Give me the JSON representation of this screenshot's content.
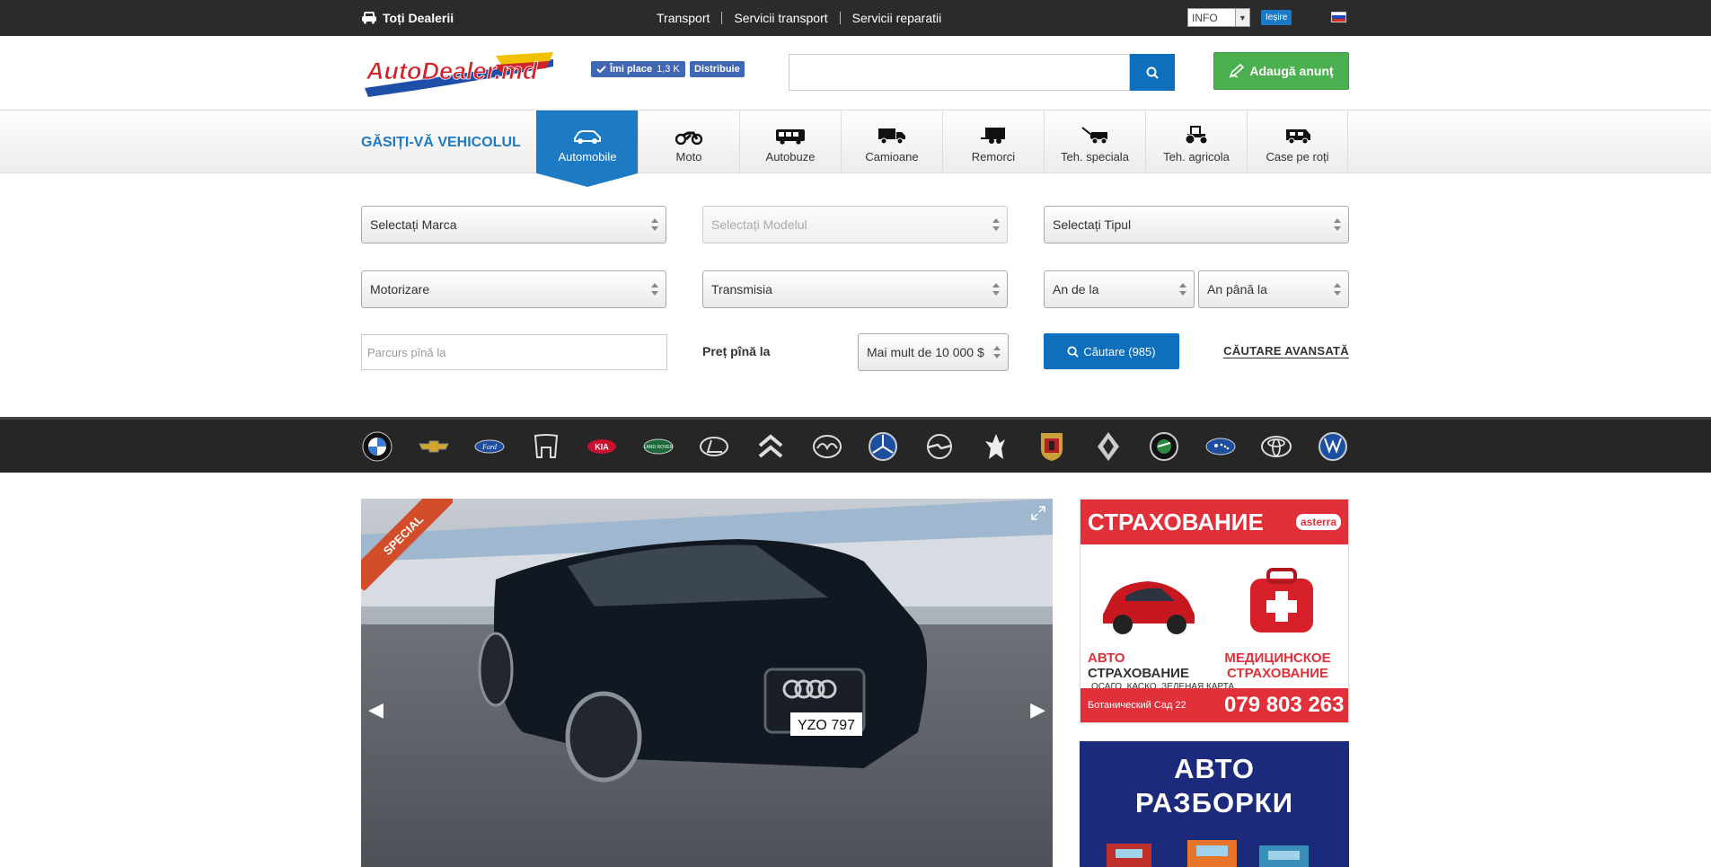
{
  "topbar": {
    "dealers_label": "Toți Dealerii",
    "nav": [
      "Transport",
      "Servicii transport",
      "Servicii reparatii"
    ],
    "info_select": "INFO",
    "logout": "Ieșire"
  },
  "header": {
    "logo_text": "AutoDealer.md",
    "fb_like_label": "Îmi place",
    "fb_like_count": "1,3 K",
    "fb_share": "Distribuie",
    "search_placeholder": "",
    "add_button": "Adaugă anunț"
  },
  "vehicle_nav": {
    "title": "GĂSIȚI-VĂ VEHICOLUL",
    "tabs": [
      "Automobile",
      "Moto",
      "Autobuze",
      "Camioane",
      "Remorci",
      "Teh. speciala",
      "Teh. agricola",
      "Case pe roți"
    ],
    "active": "Automobile"
  },
  "filters": {
    "brand": "Selectați Marca",
    "model": "Selectați Modelul",
    "type": "Selectați Tipul",
    "engine": "Motorizare",
    "transmission": "Transmisia",
    "year_from": "An de la",
    "year_to": "An până la",
    "mileage_placeholder": "Parcurs pînă la",
    "price_label": "Preț pînă la",
    "price_value": "Mai mult de 10 000 $",
    "search_button": "Căutare (985)",
    "advanced": "CĂUTARE AVANSATĂ"
  },
  "brands": [
    "BMW",
    "Chevrolet",
    "Ford",
    "Honda",
    "KIA",
    "Land Rover",
    "Lexus",
    "Citroen",
    "Mazda",
    "Mercedes-Benz",
    "Opel",
    "Peugeot",
    "Porsche",
    "Renault",
    "Skoda",
    "Subaru",
    "Toyota",
    "Volkswagen"
  ],
  "slider": {
    "badge": "SPECIAL",
    "plate": "YZO 797"
  },
  "ads": {
    "ad1_title": "СТРАХОВАНИЕ",
    "ad1_brand": "asterra",
    "ad1_left_em": "АВТО",
    "ad1_left_rest": "СТРАХОВАНИЕ",
    "ad1_left_sub": "ОСАГО, КАСКО, ЗЕЛЕНАЯ КАРТА",
    "ad1_right": "МЕДИЦИНСКОЕ СТРАХОВАНИЕ",
    "ad1_address": "Ботанический Сад 22",
    "ad1_phone": "079 803 263",
    "ad2_line1": "АВТО",
    "ad2_line2": "РАЗБОРКИ"
  },
  "colors": {
    "topbar": "#2b2b2b",
    "accent_blue": "#1d7bc6",
    "add_green": "#4cb050",
    "ad_red": "#e2303a"
  }
}
